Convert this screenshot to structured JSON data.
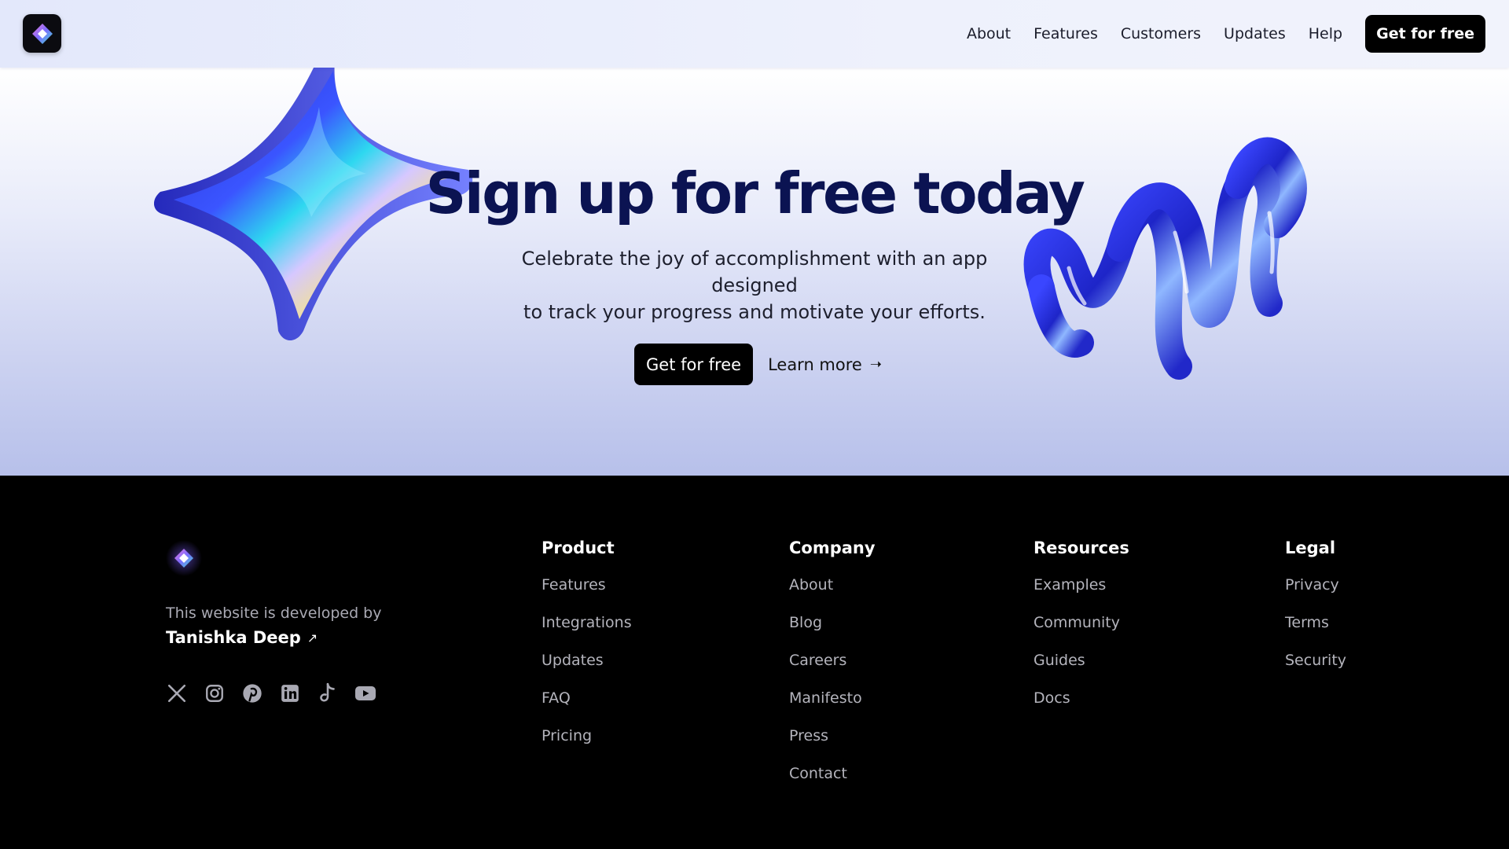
{
  "header": {
    "nav": [
      "About",
      "Features",
      "Customers",
      "Updates",
      "Help"
    ],
    "cta": "Get for free"
  },
  "hero": {
    "title": "Sign up for free today",
    "subtitle_line1": "Celebrate the joy of accomplishment with an app designed",
    "subtitle_line2": "to track your progress and motivate your efforts.",
    "cta": "Get for free",
    "learn_more": "Learn more",
    "learn_more_icon": "arrow-right-icon"
  },
  "footer": {
    "dev_text": "This website is developed by",
    "author": "Tanishka Deep",
    "author_icon": "external-link-icon",
    "socials": [
      "x-icon",
      "instagram-icon",
      "pinterest-icon",
      "linkedin-icon",
      "tiktok-icon",
      "youtube-icon"
    ],
    "columns": [
      {
        "title": "Product",
        "links": [
          "Features",
          "Integrations",
          "Updates",
          "FAQ",
          "Pricing"
        ]
      },
      {
        "title": "Company",
        "links": [
          "About",
          "Blog",
          "Careers",
          "Manifesto",
          "Press",
          "Contact"
        ]
      },
      {
        "title": "Resources",
        "links": [
          "Examples",
          "Community",
          "Guides",
          "Docs"
        ]
      },
      {
        "title": "Legal",
        "links": [
          "Privacy",
          "Terms",
          "Security"
        ]
      }
    ]
  },
  "colors": {
    "heading": "#0b1352",
    "accent_blue": "#2a35d6",
    "footer_bg": "#000000",
    "footer_link": "#b4b4bc"
  }
}
